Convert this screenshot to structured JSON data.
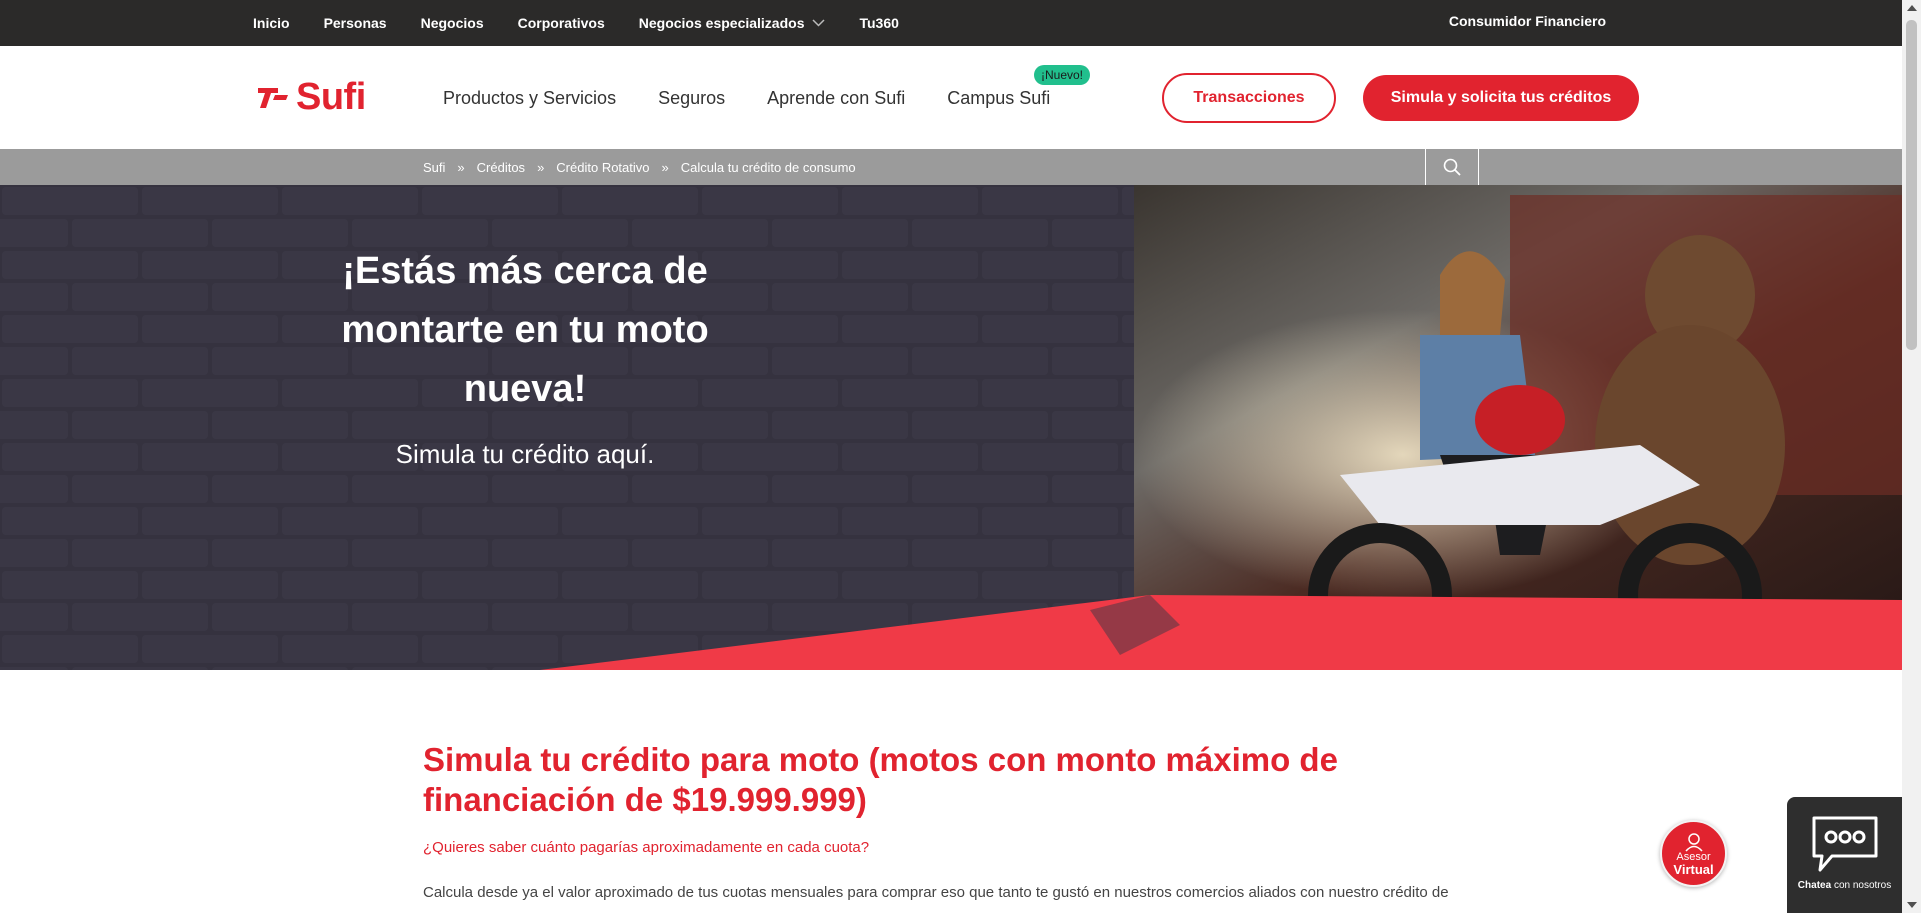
{
  "topbar": {
    "items": [
      "Inicio",
      "Personas",
      "Negocios",
      "Corporativos",
      "Negocios especializados",
      "Tu360"
    ],
    "right_link": "Consumidor Financiero"
  },
  "header": {
    "logo_text": "Sufi",
    "nav": [
      "Productos y Servicios",
      "Seguros",
      "Aprende con Sufi",
      "Campus Sufi"
    ],
    "new_badge": "¡Nuevo!",
    "btn_transactions": "Transacciones",
    "btn_simulate": "Simula y solicita tus créditos"
  },
  "breadcrumb": {
    "items": [
      "Sufi",
      "Créditos",
      "Crédito Rotativo",
      "Calcula tu crédito de consumo"
    ],
    "separator": "»"
  },
  "hero": {
    "title": "¡Estás más cerca de montarte en tu moto nueva!",
    "subtitle": "Simula tu crédito aquí."
  },
  "content": {
    "heading": "Simula tu crédito para moto (motos con monto máximo de financiación de $19.999.999)",
    "question": "¿Quieres saber cuánto pagarías aproximadamente en cada cuota?",
    "paragraph": "Calcula desde ya el valor aproximado de tus cuotas mensuales para comprar eso que tanto te gustó en nuestros comercios aliados con nuestro crédito de"
  },
  "floating": {
    "asesor_line1": "Asesor",
    "asesor_line2": "Virtual",
    "chat_bold": "Chatea",
    "chat_rest": "con nosotros"
  },
  "colors": {
    "brand_red": "#e1232f",
    "topbar": "#2b2a29",
    "breadcrumb_bar": "#9b9b9b",
    "badge_green": "#21bf8d",
    "hero_bg": "#33303d"
  },
  "icons": [
    "chevron-down-icon",
    "search-icon",
    "sufi-logo-icon",
    "advisor-icon",
    "chat-bubble-icon"
  ]
}
